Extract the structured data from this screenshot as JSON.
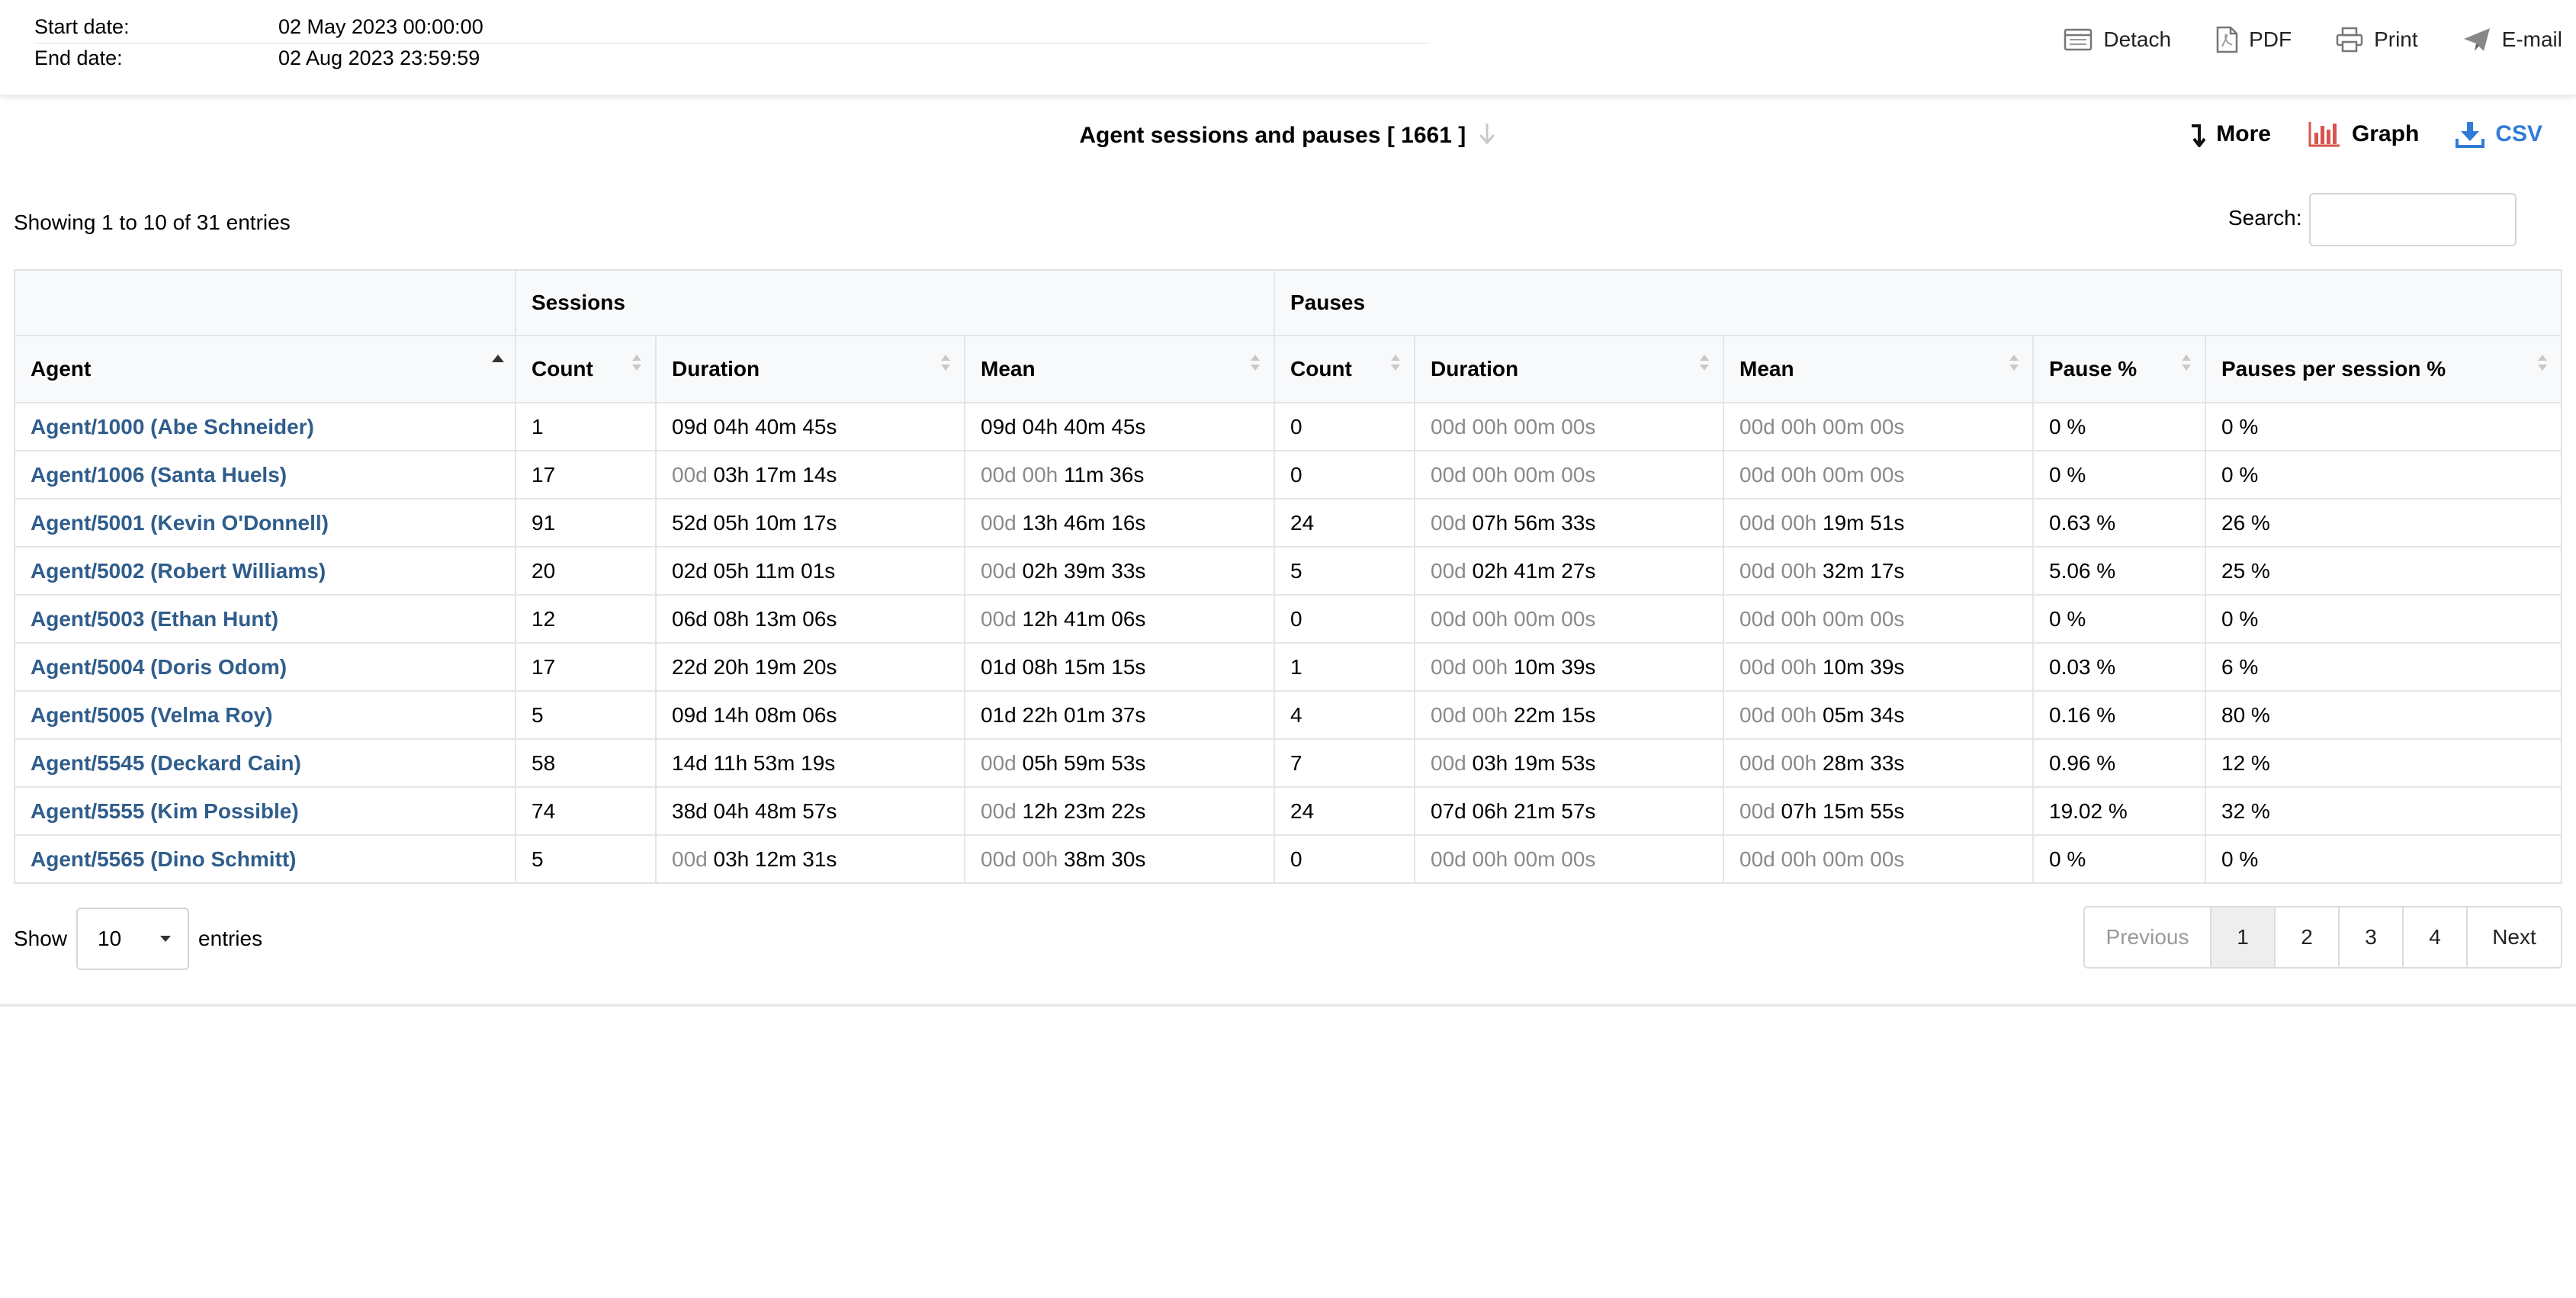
{
  "header": {
    "start_label": "Start date:",
    "start_value": "02 May 2023 00:00:00",
    "end_label": "End date:",
    "end_value": "02 Aug 2023 23:59:59",
    "actions": {
      "detach": "Detach",
      "pdf": "PDF",
      "print": "Print",
      "email": "E-mail"
    }
  },
  "report": {
    "title": "Agent sessions and pauses [ 1661 ]",
    "tools": {
      "more": "More",
      "graph": "Graph",
      "csv": "CSV"
    }
  },
  "table_info": "Showing 1 to 10 of 31 entries",
  "search": {
    "label": "Search:",
    "value": ""
  },
  "table": {
    "groups": {
      "sessions": "Sessions",
      "pauses": "Pauses"
    },
    "columns": [
      "Agent",
      "Count",
      "Duration",
      "Mean",
      "Count",
      "Duration",
      "Mean",
      "Pause %",
      "Pauses per session %"
    ],
    "rows": [
      [
        "Agent/1000 (Abe Schneider)",
        "1",
        [
          "",
          "09d 04h 40m 45s"
        ],
        [
          "",
          "09d 04h 40m 45s"
        ],
        "0",
        [
          "00d 00h 00m 00s",
          ""
        ],
        [
          "00d 00h 00m 00s",
          ""
        ],
        "0 %",
        "0 %"
      ],
      [
        "Agent/1006 (Santa Huels)",
        "17",
        [
          "00d ",
          "03h 17m 14s"
        ],
        [
          "00d 00h ",
          "11m 36s"
        ],
        "0",
        [
          "00d 00h 00m 00s",
          ""
        ],
        [
          "00d 00h 00m 00s",
          ""
        ],
        "0 %",
        "0 %"
      ],
      [
        "Agent/5001 (Kevin O'Donnell)",
        "91",
        [
          "",
          "52d 05h 10m 17s"
        ],
        [
          "00d ",
          "13h 46m 16s"
        ],
        "24",
        [
          "00d ",
          "07h 56m 33s"
        ],
        [
          "00d 00h ",
          "19m 51s"
        ],
        "0.63 %",
        "26 %"
      ],
      [
        "Agent/5002 (Robert Williams)",
        "20",
        [
          "",
          "02d 05h 11m 01s"
        ],
        [
          "00d ",
          "02h 39m 33s"
        ],
        "5",
        [
          "00d ",
          "02h 41m 27s"
        ],
        [
          "00d 00h ",
          "32m 17s"
        ],
        "5.06 %",
        "25 %"
      ],
      [
        "Agent/5003 (Ethan Hunt)",
        "12",
        [
          "",
          "06d 08h 13m 06s"
        ],
        [
          "00d ",
          "12h 41m 06s"
        ],
        "0",
        [
          "00d 00h 00m 00s",
          ""
        ],
        [
          "00d 00h 00m 00s",
          ""
        ],
        "0 %",
        "0 %"
      ],
      [
        "Agent/5004 (Doris Odom)",
        "17",
        [
          "",
          "22d 20h 19m 20s"
        ],
        [
          "",
          "01d 08h 15m 15s"
        ],
        "1",
        [
          "00d 00h ",
          "10m 39s"
        ],
        [
          "00d 00h ",
          "10m 39s"
        ],
        "0.03 %",
        "6 %"
      ],
      [
        "Agent/5005 (Velma Roy)",
        "5",
        [
          "",
          "09d 14h 08m 06s"
        ],
        [
          "",
          "01d 22h 01m 37s"
        ],
        "4",
        [
          "00d 00h ",
          "22m 15s"
        ],
        [
          "00d 00h ",
          "05m 34s"
        ],
        "0.16 %",
        "80 %"
      ],
      [
        "Agent/5545 (Deckard Cain)",
        "58",
        [
          "",
          "14d 11h 53m 19s"
        ],
        [
          "00d ",
          "05h 59m 53s"
        ],
        "7",
        [
          "00d ",
          "03h 19m 53s"
        ],
        [
          "00d 00h ",
          "28m 33s"
        ],
        "0.96 %",
        "12 %"
      ],
      [
        "Agent/5555 (Kim Possible)",
        "74",
        [
          "",
          "38d 04h 48m 57s"
        ],
        [
          "00d ",
          "12h 23m 22s"
        ],
        "24",
        [
          "",
          "07d 06h 21m 57s"
        ],
        [
          "00d ",
          "07h 15m 55s"
        ],
        "19.02 %",
        "32 %"
      ],
      [
        "Agent/5565 (Dino Schmitt)",
        "5",
        [
          "00d ",
          "03h 12m 31s"
        ],
        [
          "00d 00h ",
          "38m 30s"
        ],
        "0",
        [
          "00d 00h 00m 00s",
          ""
        ],
        [
          "00d 00h 00m 00s",
          ""
        ],
        "0 %",
        "0 %"
      ]
    ]
  },
  "footer": {
    "show_label": "Show",
    "length_value": "10",
    "entries_label": "entries",
    "pagination": {
      "previous": "Previous",
      "pages": [
        "1",
        "2",
        "3",
        "4"
      ],
      "current": "1",
      "next": "Next"
    }
  },
  "colors": {
    "link": "#2f5d8c",
    "muted": "#8a8a8a",
    "graph_icon": "#d9534f",
    "csv_icon": "#2f7bd6"
  }
}
